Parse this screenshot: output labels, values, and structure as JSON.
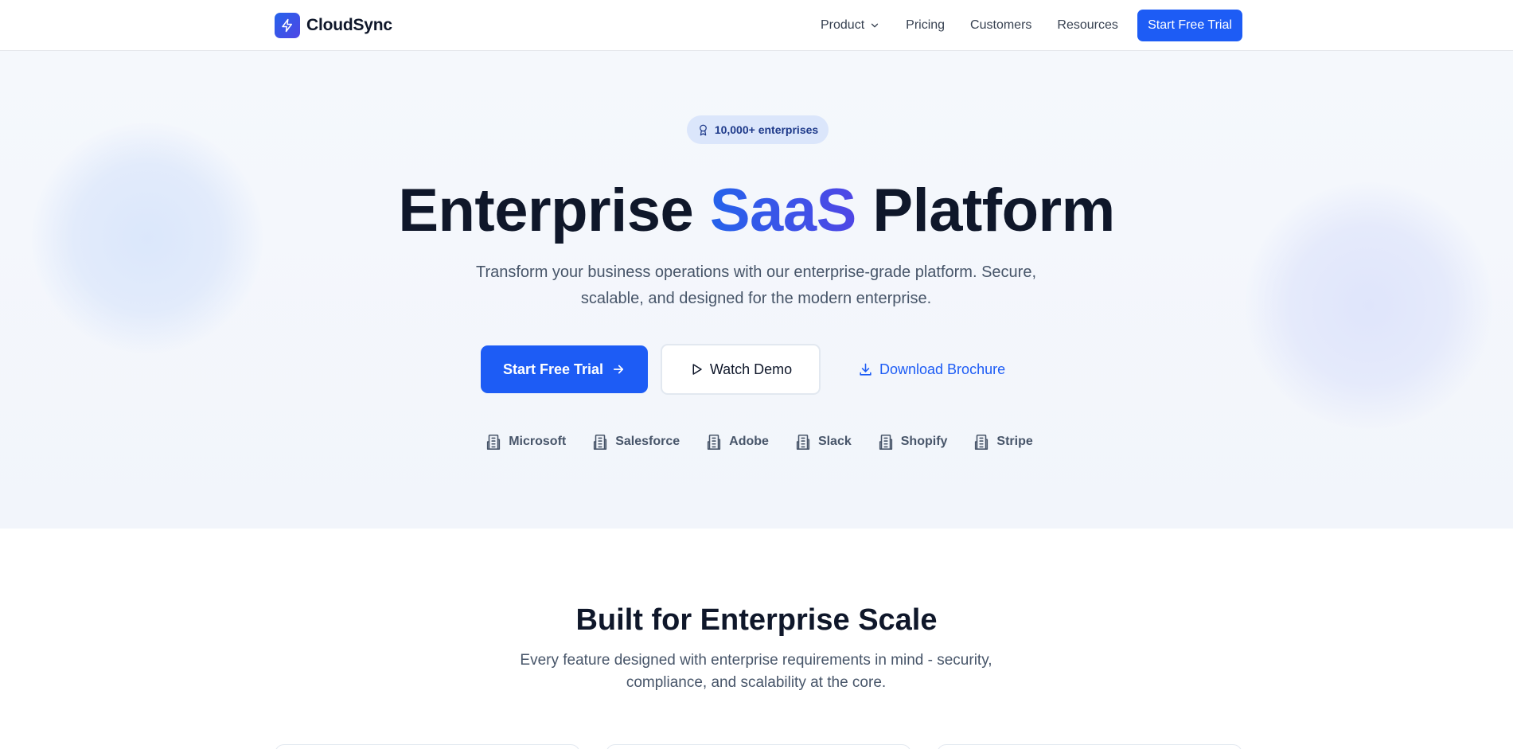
{
  "nav": {
    "brand": "CloudSync",
    "links": [
      {
        "label": "Product"
      },
      {
        "label": "Pricing"
      },
      {
        "label": "Customers"
      },
      {
        "label": "Resources"
      }
    ],
    "cta": "Start Free Trial"
  },
  "hero": {
    "badge": "10,000+ enterprises",
    "title_start": "Enterprise",
    "title_accent": "SaaS",
    "title_end": "Platform",
    "subtitle": "Transform your business operations with our enterprise-grade platform. Secure, scalable, and designed for the modern enterprise.",
    "primary_button": "Start Free Trial",
    "secondary_button": "Watch Demo",
    "link_button": "Download Brochure",
    "customer_logos": [
      "Microsoft",
      "Salesforce",
      "Adobe",
      "Slack",
      "Shopify",
      "Stripe"
    ]
  },
  "features": {
    "title": "Built for Enterprise Scale",
    "subtitle": "Every feature designed with enterprise requirements in mind - security, compliance, and scalability at the core."
  },
  "colors": {
    "primary": "#1d5cf5",
    "accent_gradient_start": "#2563eb",
    "accent_gradient_end": "#4f46e5",
    "heading": "#0f172a",
    "body_text": "#475569",
    "hero_bg": "#f4f7fc"
  },
  "icons": {
    "logo": "lightning-icon",
    "badge": "award-icon",
    "product_dropdown": "chevron-down-icon",
    "primary_button": "arrow-right-icon",
    "secondary_button": "play-icon",
    "link_button": "download-icon",
    "customer_logo": "building-icon"
  }
}
